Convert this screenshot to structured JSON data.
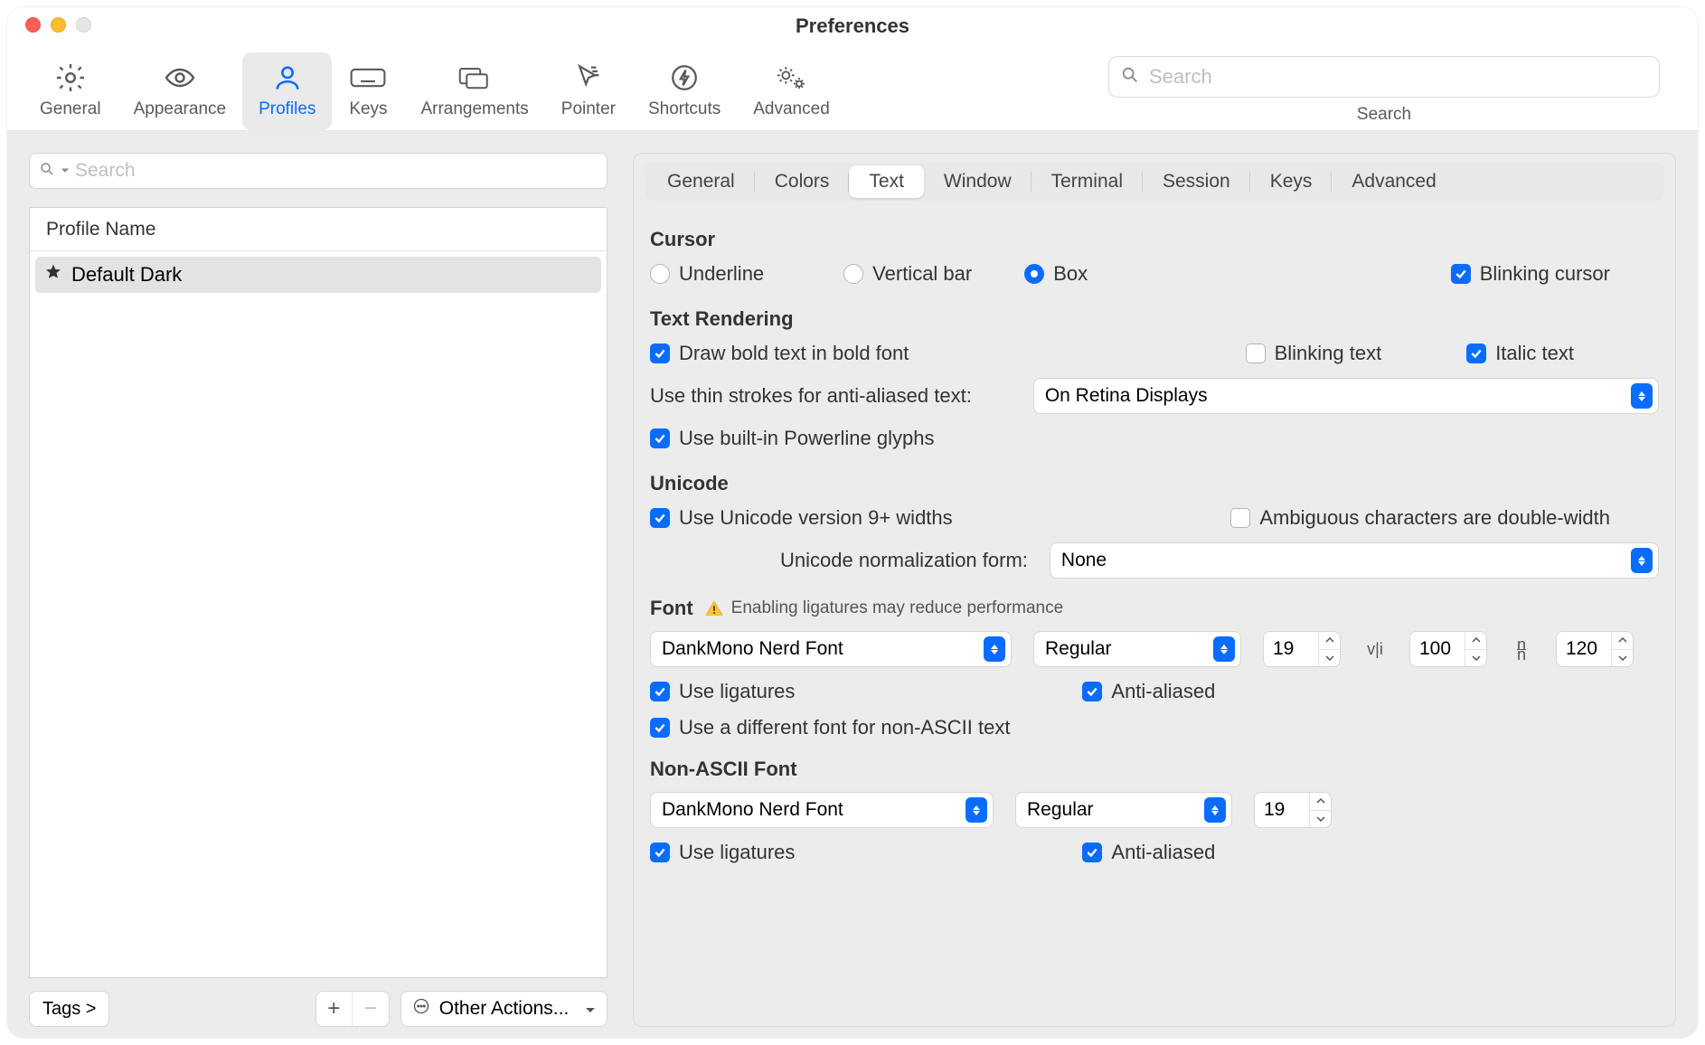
{
  "title": "Preferences",
  "toolbar": {
    "items": [
      {
        "label": "General"
      },
      {
        "label": "Appearance"
      },
      {
        "label": "Profiles"
      },
      {
        "label": "Keys"
      },
      {
        "label": "Arrangements"
      },
      {
        "label": "Pointer"
      },
      {
        "label": "Shortcuts"
      },
      {
        "label": "Advanced"
      }
    ],
    "search_placeholder": "Search",
    "search_label": "Search"
  },
  "profiles": {
    "search_placeholder": "Search",
    "header": "Profile Name",
    "items": [
      {
        "name": "Default Dark",
        "starred": true
      }
    ],
    "tags_label": "Tags >",
    "other_actions": "Other Actions..."
  },
  "subtabs": [
    "General",
    "Colors",
    "Text",
    "Window",
    "Terminal",
    "Session",
    "Keys",
    "Advanced"
  ],
  "active_subtab": "Text",
  "text_pane": {
    "cursor": {
      "heading": "Cursor",
      "underline": "Underline",
      "vertical_bar": "Vertical bar",
      "box": "Box",
      "blinking": "Blinking cursor"
    },
    "rendering": {
      "heading": "Text Rendering",
      "bold": "Draw bold text in bold font",
      "blinking_text": "Blinking text",
      "italic": "Italic text",
      "thin_strokes_label": "Use thin strokes for anti-aliased text:",
      "thin_strokes_value": "On Retina Displays",
      "powerline": "Use built-in Powerline glyphs"
    },
    "unicode": {
      "heading": "Unicode",
      "v9": "Use Unicode version 9+ widths",
      "ambiguous": "Ambiguous characters are double-width",
      "norm_label": "Unicode normalization form:",
      "norm_value": "None"
    },
    "font": {
      "heading": "Font",
      "warning": "Enabling ligatures may reduce performance",
      "family": "DankMono Nerd Font",
      "weight": "Regular",
      "size": "19",
      "hspacing": "100",
      "vspacing": "120",
      "use_ligatures": "Use ligatures",
      "anti_aliased": "Anti-aliased",
      "diff_nonascii": "Use a different font for non-ASCII text"
    },
    "nonascii": {
      "heading": "Non-ASCII Font",
      "family": "DankMono Nerd Font",
      "weight": "Regular",
      "size": "19",
      "use_ligatures": "Use ligatures",
      "anti_aliased": "Anti-aliased"
    }
  }
}
